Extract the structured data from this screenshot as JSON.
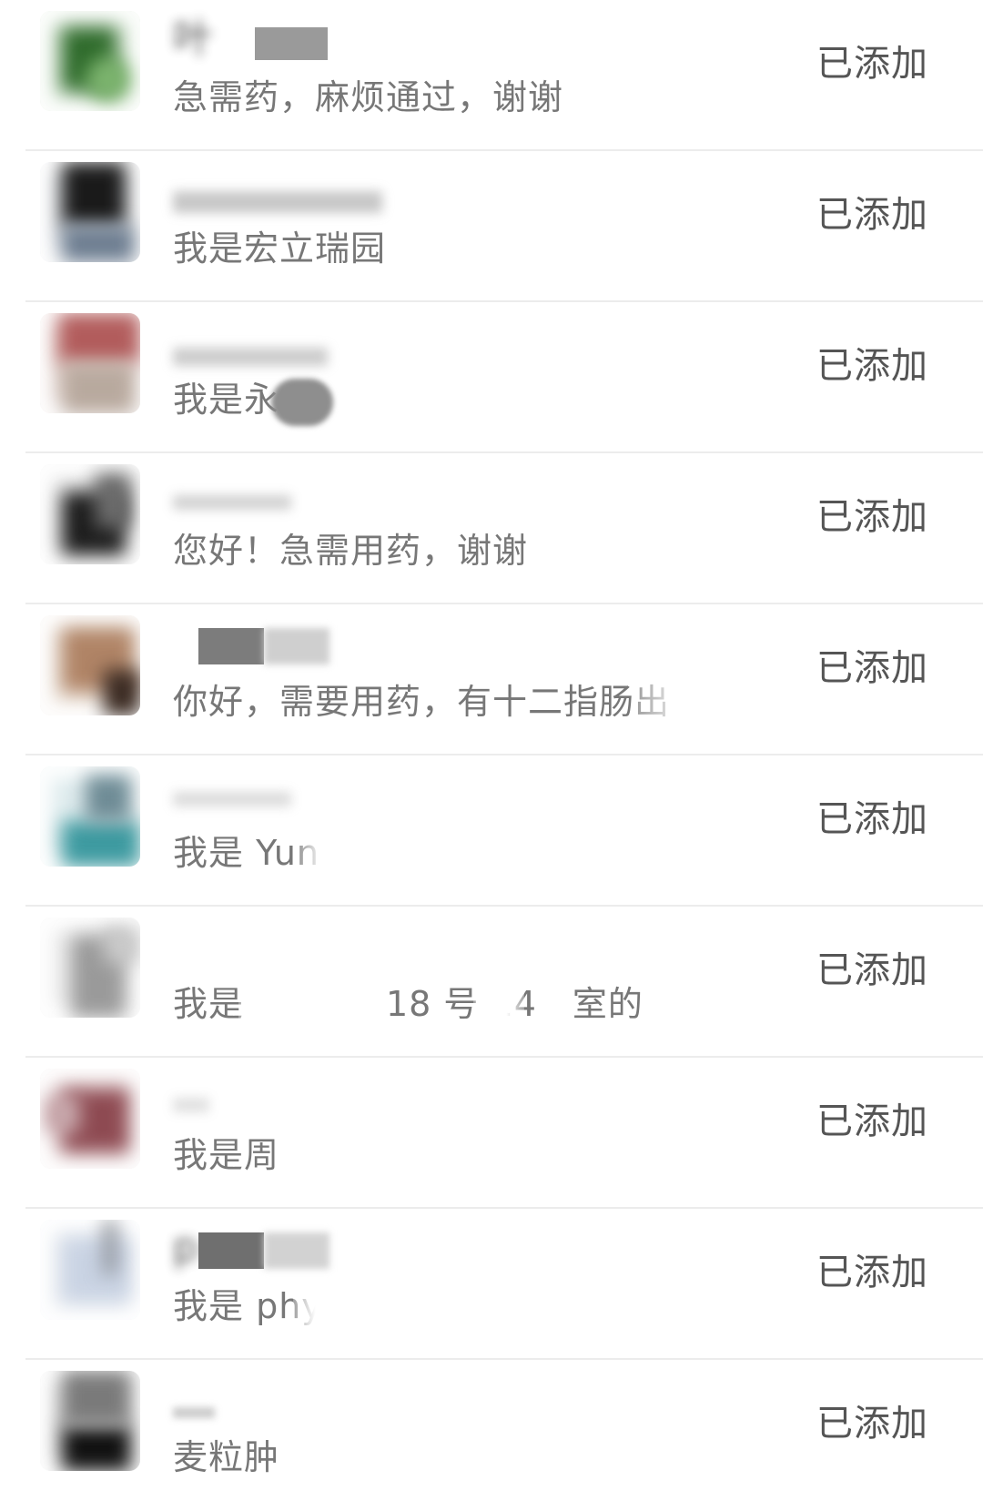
{
  "contacts": [
    {
      "name": "叶",
      "note": "急需药，麻烦通过，谢谢",
      "status": "已添加",
      "avatar": {
        "bg": "#d8e8d6",
        "a": "#2f6b2c",
        "b": "#7bb36d"
      }
    },
    {
      "name": "",
      "note": "我是宏立瑞园",
      "status": "已添加",
      "avatar": {
        "bg": "#e3e6ea",
        "a": "#1a1a1a",
        "b": "#6d7d90"
      }
    },
    {
      "name": "",
      "note": "我是永",
      "status": "已添加",
      "avatar": {
        "bg": "#e9dcd8",
        "a": "#b25c5c",
        "b": "#b8a99e"
      }
    },
    {
      "name": "",
      "note": "您好！急需用药，谢谢",
      "status": "已添加",
      "avatar": {
        "bg": "#ececec",
        "a": "#1c1c1c",
        "b": "#6b6b6b"
      }
    },
    {
      "name": "",
      "note": "你好，需要用药，有十二指肠出",
      "status": "已添加",
      "avatar": {
        "bg": "#efe7df",
        "a": "#b08466",
        "b": "#3a2a22"
      }
    },
    {
      "name": "",
      "note": "我是 Yun",
      "status": "已添加",
      "avatar": {
        "bg": "#dfecee",
        "a": "#3d9aa0",
        "b": "#6e8b95"
      }
    },
    {
      "name": "",
      "note": "我是　　　　18 号 14　室的",
      "status": "已添加",
      "avatar": {
        "bg": "#eeeeee",
        "a": "#9a9a9a",
        "b": "#c9c9c9"
      }
    },
    {
      "name": "",
      "note": "我是周",
      "status": "已添加",
      "avatar": {
        "bg": "#efe4e4",
        "a": "#8e4a52",
        "b": "#c6a5a9"
      }
    },
    {
      "name": "p",
      "note": "我是 phy",
      "status": "已添加",
      "avatar": {
        "bg": "#eef1f5",
        "a": "#c9d3e3",
        "b": "#8b8f96"
      }
    },
    {
      "name": "",
      "note": "麦粒肿",
      "status": "已添加",
      "avatar": {
        "bg": "#e6e6e6",
        "a": "#111111",
        "b": "#7a7a7a"
      }
    }
  ]
}
